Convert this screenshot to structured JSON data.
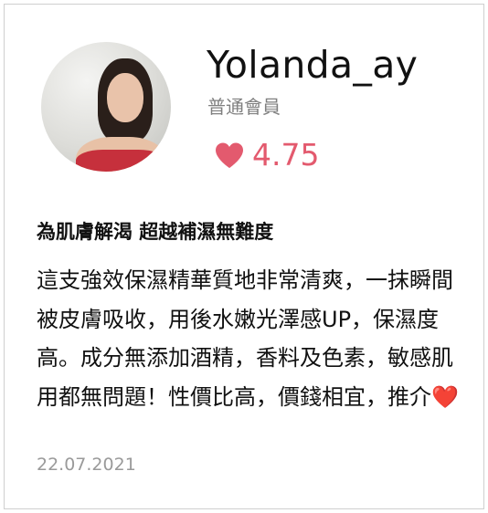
{
  "user": {
    "name": "Yolanda_ay",
    "member_level": "普通會員",
    "rating": "4.75"
  },
  "review": {
    "title": "為肌膚解渴 超越補濕無難度",
    "body": "這支強效保濕精華質地非常清爽，一抹瞬間被皮膚吸收，用後水嫩光澤感UP，保濕度高。成分無添加酒精，香料及色素，敏感肌用都無問題！性價比高，價錢相宜，推介❤️",
    "date": "22.07.2021"
  },
  "colors": {
    "accent": "#e35a6e",
    "muted": "#7f7f7f",
    "date": "#9a9a9a"
  },
  "icons": {
    "rating": "heart-icon"
  }
}
